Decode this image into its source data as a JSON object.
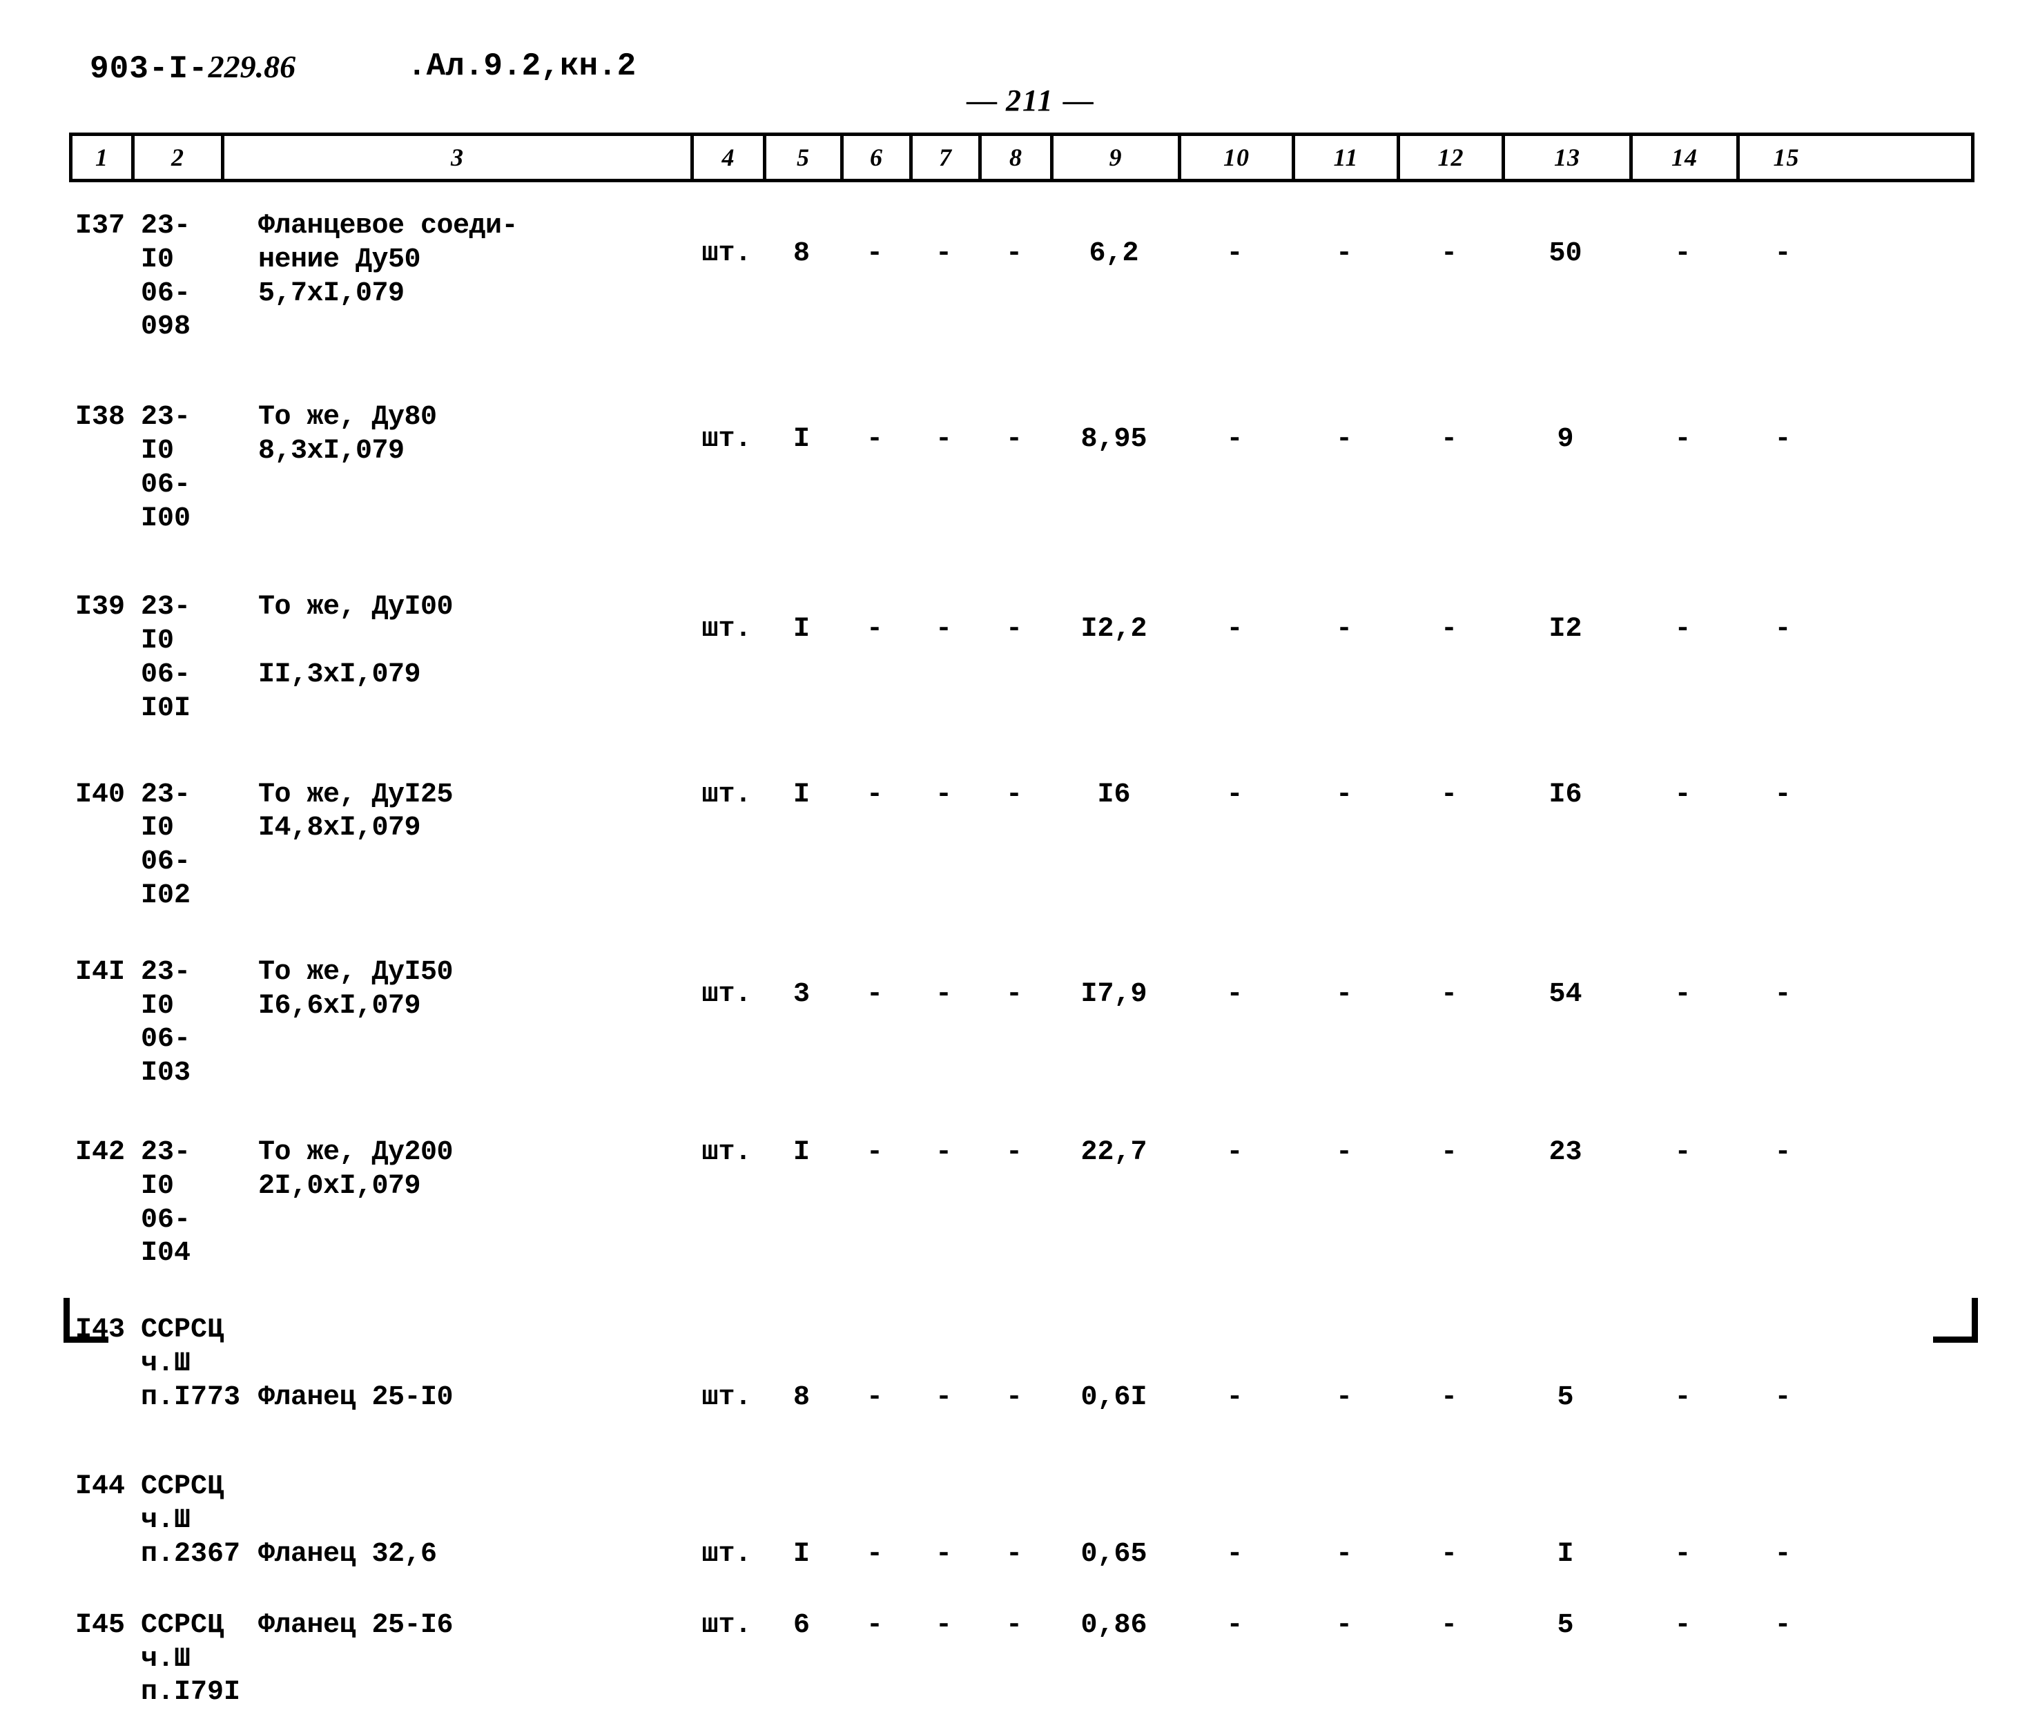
{
  "header": {
    "doc_code_prefix": "903-I-",
    "doc_code_hand": "229.86",
    "album": ".Ал.9.2,кн.2",
    "page_dash_left": "—",
    "page_number": "211",
    "page_dash_right": "—"
  },
  "table": {
    "column_headers": [
      "1",
      "2",
      "3",
      "4",
      "5",
      "6",
      "7",
      "8",
      "9",
      "10",
      "11",
      "12",
      "13",
      "14",
      "15"
    ],
    "dash": "-",
    "rows": [
      {
        "num": "I37",
        "code": [
          "23-I0",
          "06-098"
        ],
        "name": [
          "Фланцевое соеди-",
          "нение Ду50",
          "5,7xI,079"
        ],
        "unit": "шт.",
        "c5": "8",
        "c6": "-",
        "c7": "-",
        "c8": "-",
        "c9": "6,2",
        "c10": "-",
        "c11": "-",
        "c12": "-",
        "c13": "50",
        "c14": "-",
        "c15": "-"
      },
      {
        "num": "I38",
        "code": [
          "23-I0",
          "06-I00"
        ],
        "name": [
          "То же, Ду80",
          "8,3xI,079"
        ],
        "unit": "шт.",
        "c5": "I",
        "c6": "-",
        "c7": "-",
        "c8": "-",
        "c9": "8,95",
        "c10": "-",
        "c11": "-",
        "c12": "-",
        "c13": "9",
        "c14": "-",
        "c15": "-"
      },
      {
        "num": "I39",
        "code": [
          "23-I0",
          "06-I0I"
        ],
        "name": [
          "То же, ДуI00",
          "",
          "II,3xI,079"
        ],
        "unit": "шт.",
        "c5": "I",
        "c6": "-",
        "c7": "-",
        "c8": "-",
        "c9": "I2,2",
        "c10": "-",
        "c11": "-",
        "c12": "-",
        "c13": "I2",
        "c14": "-",
        "c15": "-"
      },
      {
        "num": "I40",
        "code": [
          "23-I0",
          "06-I02"
        ],
        "name": [
          "То же, ДуI25",
          "I4,8xI,079"
        ],
        "unit": "шт.",
        "c5": "I",
        "c6": "-",
        "c7": "-",
        "c8": "-",
        "c9": "I6",
        "c10": "-",
        "c11": "-",
        "c12": "-",
        "c13": "I6",
        "c14": "-",
        "c15": "-"
      },
      {
        "num": "I4I",
        "code": [
          "23-I0",
          "06-I03"
        ],
        "name": [
          "То же, ДуI50",
          "I6,6xI,079"
        ],
        "unit": "шт.",
        "c5": "3",
        "c6": "-",
        "c7": "-",
        "c8": "-",
        "c9": "I7,9",
        "c10": "-",
        "c11": "-",
        "c12": "-",
        "c13": "54",
        "c14": "-",
        "c15": "-"
      },
      {
        "num": "I42",
        "code": [
          "23-I0",
          "06-I04"
        ],
        "name": [
          "То же, Ду200",
          "2I,0xI,079"
        ],
        "unit": "шт.",
        "c5": "I",
        "c6": "-",
        "c7": "-",
        "c8": "-",
        "c9": "22,7",
        "c10": "-",
        "c11": "-",
        "c12": "-",
        "c13": "23",
        "c14": "-",
        "c15": "-"
      },
      {
        "num": "I43",
        "code": [
          "ССРСЦ",
          "ч.Ш",
          "п.I773"
        ],
        "name": [
          "",
          "",
          "Фланец 25-I0"
        ],
        "unit": "шт.",
        "c5": "8",
        "c6": "-",
        "c7": "-",
        "c8": "-",
        "c9": "0,6I",
        "c10": "-",
        "c11": "-",
        "c12": "-",
        "c13": "5",
        "c14": "-",
        "c15": "-"
      },
      {
        "num": "I44",
        "code": [
          "ССРСЦ",
          "ч.Ш",
          "п.2367"
        ],
        "name": [
          "",
          "",
          "Фланец 32,6"
        ],
        "unit": "шт.",
        "c5": "I",
        "c6": "-",
        "c7": "-",
        "c8": "-",
        "c9": "0,65",
        "c10": "-",
        "c11": "-",
        "c12": "-",
        "c13": "I",
        "c14": "-",
        "c15": "-"
      },
      {
        "num": "I45",
        "code": [
          "ССРСЦ",
          "ч.Ш",
          "п.I79I"
        ],
        "name": [
          "Фланец 25-I6",
          "",
          ""
        ],
        "unit": "шт.",
        "c5": "6",
        "c6": "-",
        "c7": "-",
        "c8": "-",
        "c9": "0,86",
        "c10": "-",
        "c11": "-",
        "c12": "-",
        "c13": "5",
        "c14": "-",
        "c15": "-"
      }
    ]
  }
}
